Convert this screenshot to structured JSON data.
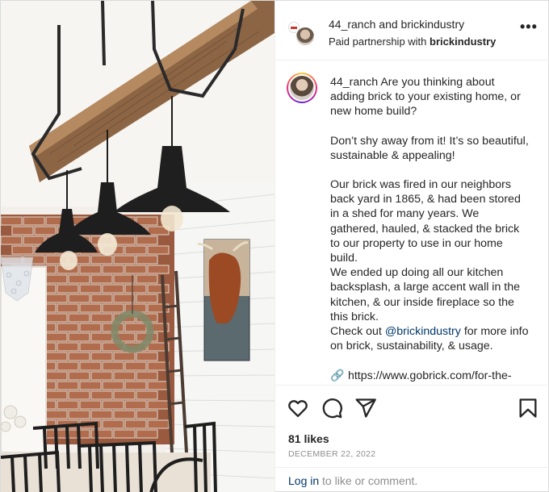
{
  "post": {
    "header": {
      "username": "44_ranch",
      "conjunction": "and",
      "collaborator": "brickindustry",
      "partnership_prefix": "Paid partnership with",
      "partnership_brand": "brickindustry",
      "more_label": "•••"
    },
    "caption": {
      "username": "44_ranch",
      "line1_text": "Are you thinking about adding brick to your existing home, or new home build?",
      "para2": "Don’t shy away from it! It’s so beautiful, sustainable & appealing!",
      "para3": "Our brick was fired in our neighbors back yard in 1865, & had been stored in a shed for many years. We gathered, hauled, & stacked the brick to our property to use in our home build.",
      "para4": "We ended up doing all our kitchen backsplash, a large accent wall in the kitchen, & our inside fireplace so the this brick.",
      "para5_prefix": "Check out",
      "mention": "@brickindustry",
      "para5_suffix": "for more info on brick, sustainability, & usage.",
      "link_icon": "🔗",
      "link_text": "https://www.gobrick.com/for-the-"
    },
    "actions": {
      "like_icon": "heart-icon",
      "comment_icon": "comment-icon",
      "share_icon": "share-icon",
      "save_icon": "bookmark-icon"
    },
    "likes": "81 likes",
    "date": "DECEMBER 22, 2022",
    "comment_bar": {
      "login_label": "Log in",
      "rest": "to like or comment."
    }
  },
  "colors": {
    "link": "#00376b",
    "muted": "#8e8e8e",
    "text": "#262626",
    "divider": "#efefef"
  }
}
